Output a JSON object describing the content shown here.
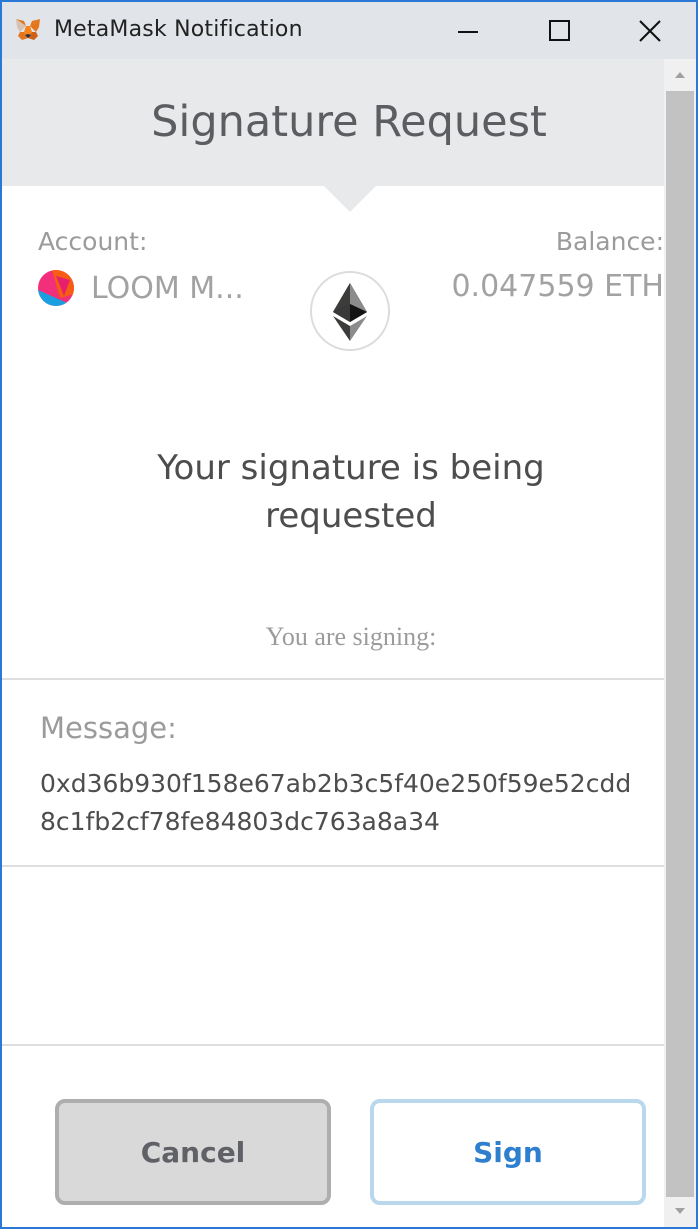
{
  "window": {
    "title": "MetaMask Notification",
    "border_color": "#2b79d6"
  },
  "icons": {
    "app": "metamask-fox-icon",
    "minimize": "minimize-icon",
    "maximize": "maximize-icon",
    "close": "close-icon",
    "token": "ethereum-icon",
    "scroll_up": "scroll-up-arrow-icon",
    "scroll_down": "scroll-down-arrow-icon"
  },
  "header": {
    "title": "Signature Request"
  },
  "account": {
    "label": "Account:",
    "name": "LOOM M...",
    "balance_label": "Balance:",
    "balance_value": "0.047559 ETH"
  },
  "request": {
    "text": "Your signature is being requested",
    "signing_label": "You are signing:"
  },
  "message": {
    "label": "Message:",
    "value": "0xd36b930f158e67ab2b3c5f40e250f59e52cdd8c1fb2cf78fe84803dc763a8a34"
  },
  "buttons": {
    "cancel": "Cancel",
    "sign": "Sign"
  },
  "colors": {
    "sign_text": "#2f7fcf",
    "header_bg": "#e7e9eb"
  }
}
